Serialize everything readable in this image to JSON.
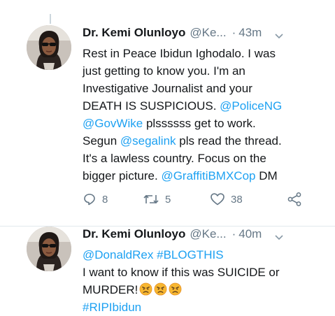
{
  "tweets": [
    {
      "author": "Dr. Kemi Olunloyo",
      "handle": "@Ke...",
      "separator": "·",
      "time": "43m",
      "lines": [
        [
          {
            "t": "Rest in Peace Ibidun Ighodalo. I was",
            "link": false
          }
        ],
        [
          {
            "t": "just getting to know you. I'm an",
            "link": false
          }
        ],
        [
          {
            "t": "Investigative Journalist and your",
            "link": false
          }
        ],
        [
          {
            "t": "DEATH IS SUSPICIOUS. ",
            "link": false
          },
          {
            "t": "@PoliceNG",
            "link": true
          }
        ],
        [
          {
            "t": "@GovWike",
            "link": true
          },
          {
            "t": " plssssss get to work.",
            "link": false
          }
        ],
        [
          {
            "t": "Segun ",
            "link": false
          },
          {
            "t": "@segalink",
            "link": true
          },
          {
            "t": " pls read the thread.",
            "link": false
          }
        ],
        [
          {
            "t": "It's a lawless country. Focus on the",
            "link": false
          }
        ],
        [
          {
            "t": "bigger picture. ",
            "link": false
          },
          {
            "t": "@GraffitiBMXCop",
            "link": true
          },
          {
            "t": " DM",
            "link": false
          }
        ]
      ],
      "actions": {
        "replies": "8",
        "retweets": "5",
        "likes": "38"
      }
    },
    {
      "author": "Dr. Kemi Olunloyo",
      "handle": "@Ke...",
      "separator": "·",
      "time": "40m",
      "lines": [
        [
          {
            "t": "@DonaldRex",
            "link": true
          },
          {
            "t": " ",
            "link": false
          },
          {
            "t": "#BLOGTHIS",
            "link": true
          }
        ],
        [
          {
            "t": "I want to know if this was SUICIDE or",
            "link": false
          }
        ],
        [
          {
            "t": "MURDER!",
            "link": false
          }
        ],
        [
          {
            "t": "#RIPIbidun",
            "link": true
          }
        ]
      ],
      "emoji": [
        "angry-face",
        "angry-face",
        "angry-face"
      ]
    }
  ],
  "colors": {
    "link": "#1da1f2",
    "muted": "#657786",
    "text": "#14171a"
  }
}
